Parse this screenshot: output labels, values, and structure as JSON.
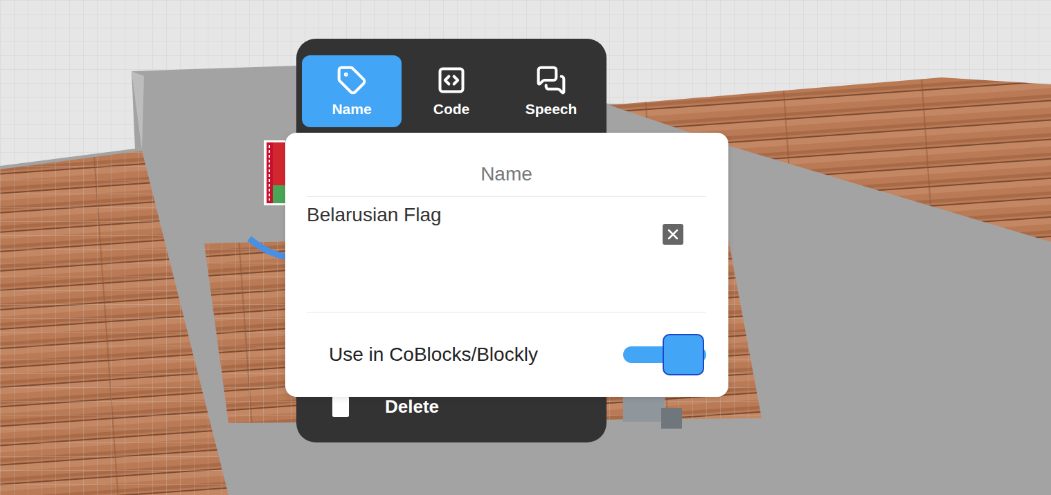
{
  "tabs": [
    {
      "label": "Name",
      "selected": true
    },
    {
      "label": "Code",
      "selected": false
    },
    {
      "label": "Speech",
      "selected": false
    }
  ],
  "name_panel": {
    "title": "Name",
    "value": "Belarusian Flag"
  },
  "toggle": {
    "label": "Use in CoBlocks/Blockly",
    "on": true
  },
  "menu_items": [
    {
      "label": "Delete"
    }
  ]
}
